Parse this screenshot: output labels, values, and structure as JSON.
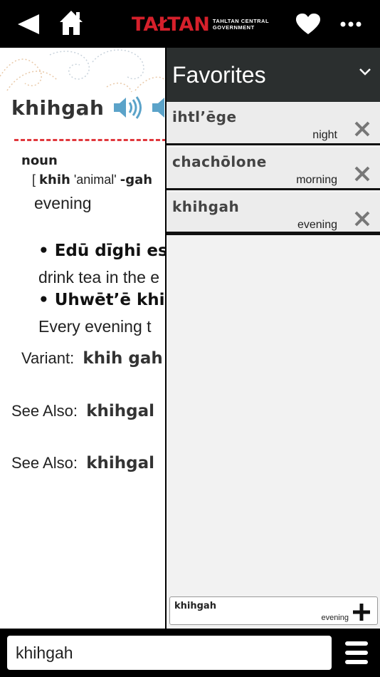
{
  "topbar": {
    "logo_word": "TAŁTAN",
    "logo_sub_line1": "TAHLTAN CENTRAL",
    "logo_sub_line2": "GOVERNMENT",
    "icons": [
      "back-icon",
      "home-icon",
      "heart-icon",
      "more-icon"
    ]
  },
  "entry": {
    "headword": "khihgah",
    "part_of_speech": "noun",
    "morph_open": "[",
    "morph_part1": "khih",
    "morph_gloss1": "'animal'",
    "morph_part2": "-gah",
    "gloss": "evening",
    "examples": [
      {
        "tahltan": "• Edū dīghi esd",
        "english": "drink tea in the e"
      },
      {
        "tahltan": "• Uhwēt’ē khih",
        "english": "Every evening t"
      }
    ],
    "variant_label": "Variant:",
    "variant_value": "khih gah",
    "see_also": [
      {
        "label": "See Also:",
        "value": "khihgal"
      },
      {
        "label": "See Also:",
        "value": "khihgal"
      }
    ]
  },
  "favorites": {
    "title": "Favorites",
    "items": [
      {
        "word": "ihtl’ēge",
        "gloss": "night"
      },
      {
        "word": "chachōlone",
        "gloss": "morning"
      },
      {
        "word": "khihgah",
        "gloss": "evening"
      }
    ],
    "current": {
      "word": "khihgah",
      "gloss": "evening"
    }
  },
  "search": {
    "value": "khihgah"
  },
  "colors": {
    "accent_red": "#d6202b",
    "speaker_blue": "#5ba3c9",
    "panel_header": "#2b2f2f"
  }
}
